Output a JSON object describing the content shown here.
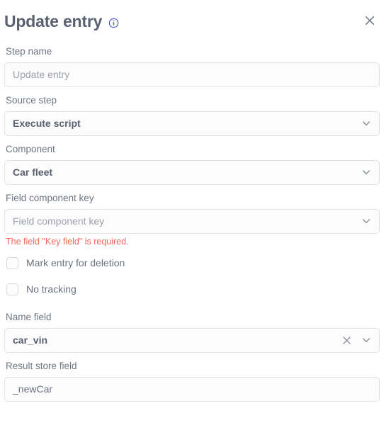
{
  "dialog": {
    "title": "Update entry",
    "info_icon": "info-circle-icon",
    "close_icon": "close-icon"
  },
  "fields": {
    "step_name": {
      "label": "Step name",
      "value": "",
      "placeholder": "Update entry"
    },
    "source_step": {
      "label": "Source step",
      "value": "Execute script",
      "chevron": "chevron-down-icon"
    },
    "component": {
      "label": "Component",
      "value": "Car fleet",
      "chevron": "chevron-down-icon"
    },
    "field_component_key": {
      "label": "Field component key",
      "value": "",
      "placeholder": "Field component key",
      "chevron": "chevron-down-icon",
      "error": "The field \"Key field\" is required."
    },
    "mark_entry_for_deletion": {
      "label": "Mark entry for deletion",
      "checked": false
    },
    "no_tracking": {
      "label": "No tracking",
      "checked": false
    },
    "name_field": {
      "label": "Name field",
      "value": "car_vin",
      "clear_icon": "close-icon",
      "chevron": "chevron-down-icon"
    },
    "result_store_field": {
      "label": "Result store field",
      "value": "_newCar",
      "placeholder": "_newCar"
    }
  },
  "colors": {
    "title": "#5a6272",
    "label": "#6e7582",
    "value": "#59606e",
    "placeholder": "#9ca1ab",
    "error": "#f2675c",
    "border": "#e2e2e6",
    "field_bg": "#fcfcfd",
    "info_accent": "#4a54d8"
  }
}
